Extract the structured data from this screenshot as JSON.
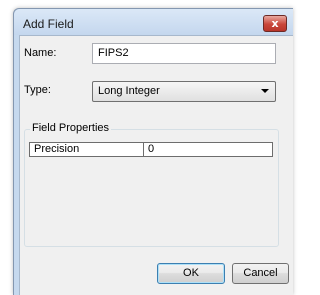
{
  "window": {
    "title": "Add Field",
    "close_glyph": "x"
  },
  "form": {
    "name_label": "Name:",
    "name_value": "FIPS2",
    "type_label": "Type:",
    "type_value": "Long Integer"
  },
  "field_properties": {
    "title": "Field Properties",
    "rows": [
      {
        "name": "Precision",
        "value": "0"
      }
    ]
  },
  "buttons": {
    "ok_label": "OK",
    "cancel_label": "Cancel"
  },
  "colors": {
    "titlebar": "#c4d7ee",
    "close_button": "#c9463a",
    "client_background": "#f0f0f0"
  },
  "icons": {
    "close": "close-icon",
    "dropdown": "chevron-down-icon"
  }
}
